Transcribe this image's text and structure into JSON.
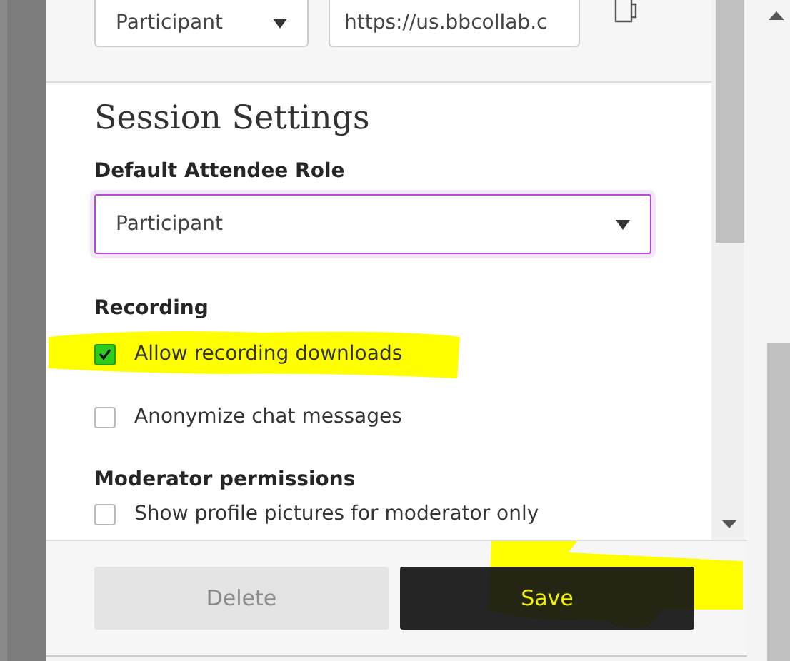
{
  "link_row": {
    "role_select": {
      "value": "Participant"
    },
    "url_field": {
      "value": "https://us.bbcollab.c"
    }
  },
  "section_title": "Session Settings",
  "default_role": {
    "label": "Default Attendee Role",
    "value": "Participant"
  },
  "groups": [
    {
      "heading": "Recording",
      "options": [
        {
          "label": "Allow recording downloads",
          "checked": true
        },
        {
          "label": "Anonymize chat messages",
          "checked": false
        }
      ]
    },
    {
      "heading": "Moderator permissions",
      "options": [
        {
          "label": "Show profile pictures for moderator only",
          "checked": false
        }
      ]
    }
  ],
  "buttons": [
    {
      "label": "Delete",
      "kind": "secondary"
    },
    {
      "label": "Save",
      "kind": "primary"
    }
  ]
}
